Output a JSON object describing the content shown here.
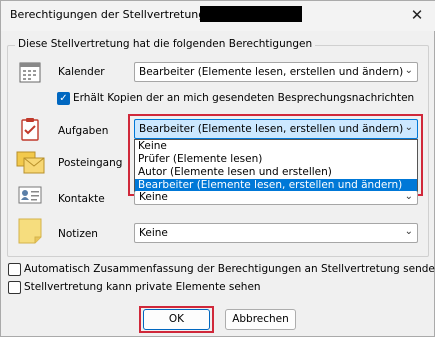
{
  "title": {
    "text": "Berechtigungen der Stellvertretung:",
    "redacted_name": ""
  },
  "group": {
    "legend": "Diese Stellvertretung hat die folgenden Berechtigungen",
    "rows": [
      {
        "key": "kalender",
        "label": "Kalender",
        "icon": "calendar-icon",
        "value": "Bearbeiter (Elemente lesen, erstellen und ändern)"
      },
      {
        "key": "aufgaben",
        "label": "Aufgaben",
        "icon": "task-clipboard-icon",
        "value": "Bearbeiter (Elemente lesen, erstellen und ändern)"
      },
      {
        "key": "posteingang",
        "label": "Posteingang",
        "icon": "inbox-envelope-icon",
        "value": ""
      },
      {
        "key": "kontakte",
        "label": "Kontakte",
        "icon": "contact-card-icon",
        "value": "Keine"
      },
      {
        "key": "notizen",
        "label": "Notizen",
        "icon": "note-icon",
        "value": "Keine"
      }
    ],
    "meeting_copy_checkbox": {
      "label": "Erhält Kopien der an mich gesendeten Besprechungsnachrichten",
      "checked": true
    }
  },
  "dropdown_options": [
    {
      "label": "Keine",
      "selected": false
    },
    {
      "label": "Prüfer (Elemente lesen)",
      "selected": false
    },
    {
      "label": "Autor (Elemente lesen und erstellen)",
      "selected": false
    },
    {
      "label": "Bearbeiter (Elemente lesen, erstellen und ändern)",
      "selected": true
    }
  ],
  "options": {
    "auto_summary": {
      "label": "Automatisch Zusammenfassung der Berechtigungen an Stellvertretung senden",
      "checked": false
    },
    "private_items": {
      "label": "Stellvertretung kann private Elemente sehen",
      "checked": false
    }
  },
  "buttons": {
    "ok": "OK",
    "cancel": "Abbrechen",
    "close": "✕"
  },
  "colors": {
    "accent": "#0078d7",
    "highlight_box": "#d0283a"
  }
}
